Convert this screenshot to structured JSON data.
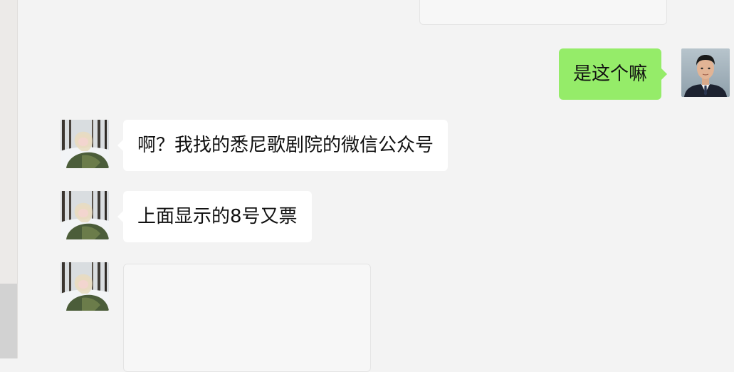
{
  "chat": {
    "messages": [
      {
        "sender": "me",
        "type": "text",
        "text": "是这个嘛",
        "avatar_icon": "man-in-suit-avatar"
      },
      {
        "sender": "contact",
        "type": "text",
        "text": "啊？我找的悉尼歌剧院的微信公众号",
        "avatar_icon": "woman-in-snowy-forest-avatar"
      },
      {
        "sender": "contact",
        "type": "text",
        "text": "上面显示的8号又票",
        "avatar_icon": "woman-in-snowy-forest-avatar"
      },
      {
        "sender": "contact",
        "type": "card",
        "avatar_icon": "woman-in-snowy-forest-avatar"
      }
    ]
  },
  "colors": {
    "outgoing_bubble": "#95ec69",
    "incoming_bubble": "#ffffff",
    "background": "#f3f3f3"
  }
}
